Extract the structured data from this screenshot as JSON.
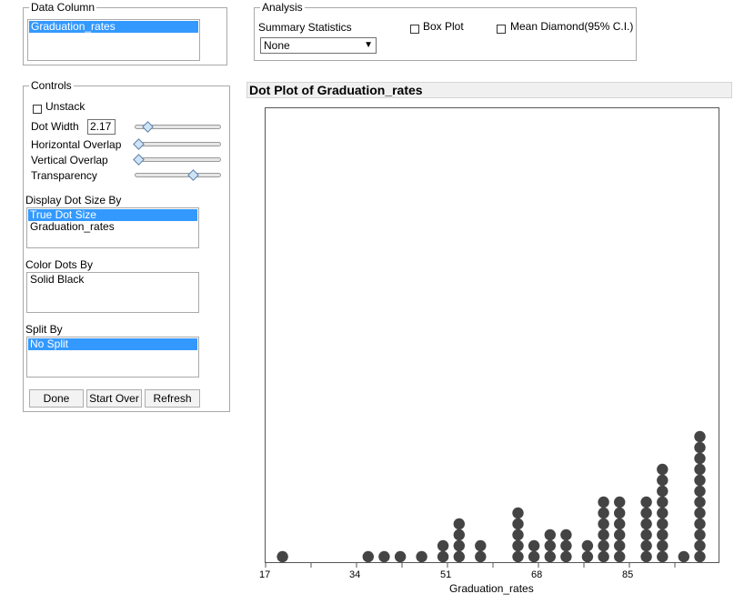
{
  "data_column": {
    "title": "Data Column",
    "items": [
      "Graduation_rates"
    ]
  },
  "analysis": {
    "title": "Analysis",
    "summary_label": "Summary Statistics",
    "summary_value": "None",
    "box_plot_label": "Box Plot",
    "mean_diamond_label": "Mean Diamond(95% C.I.)"
  },
  "controls": {
    "title": "Controls",
    "unstack_label": "Unstack",
    "dot_width_label": "Dot Width",
    "dot_width_value": "2.17",
    "horizontal_overlap_label": "Horizontal Overlap",
    "vertical_overlap_label": "Vertical Overlap",
    "transparency_label": "Transparency",
    "sliders": {
      "dot_width": 0.12,
      "horizontal_overlap": 0.0,
      "vertical_overlap": 0.0,
      "transparency": 0.7
    },
    "display_dot_size_by_label": "Display Dot Size By",
    "display_dot_size_by_items": [
      "True Dot Size",
      "Graduation_rates"
    ],
    "color_dots_by_label": "Color Dots By",
    "color_dots_by_items": [
      "Solid Black"
    ],
    "split_by_label": "Split By",
    "split_by_items": [
      "No Split"
    ],
    "done_label": "Done",
    "start_over_label": "Start Over",
    "refresh_label": "Refresh"
  },
  "plot": {
    "title": "Dot Plot of Graduation_rates",
    "xlabel": "Graduation_rates",
    "ticks": [
      "17",
      "34",
      "51",
      "68",
      "85"
    ]
  },
  "chart_data": {
    "type": "scatter",
    "title": "Dot Plot of Graduation_rates",
    "xlabel": "Graduation_rates",
    "xlim": [
      17,
      101
    ],
    "x_ticks": [
      17,
      34,
      51,
      68,
      85
    ],
    "dot_color": "#444444",
    "stacks": [
      {
        "x": 20,
        "count": 1
      },
      {
        "x": 36,
        "count": 1
      },
      {
        "x": 39,
        "count": 1
      },
      {
        "x": 42,
        "count": 1
      },
      {
        "x": 46,
        "count": 1
      },
      {
        "x": 50,
        "count": 2
      },
      {
        "x": 53,
        "count": 4
      },
      {
        "x": 57,
        "count": 2
      },
      {
        "x": 64,
        "count": 5
      },
      {
        "x": 67,
        "count": 2
      },
      {
        "x": 70,
        "count": 3
      },
      {
        "x": 73,
        "count": 3
      },
      {
        "x": 77,
        "count": 2
      },
      {
        "x": 80,
        "count": 6
      },
      {
        "x": 83,
        "count": 6
      },
      {
        "x": 88,
        "count": 6
      },
      {
        "x": 91,
        "count": 9
      },
      {
        "x": 95,
        "count": 1
      },
      {
        "x": 98,
        "count": 12
      }
    ]
  }
}
